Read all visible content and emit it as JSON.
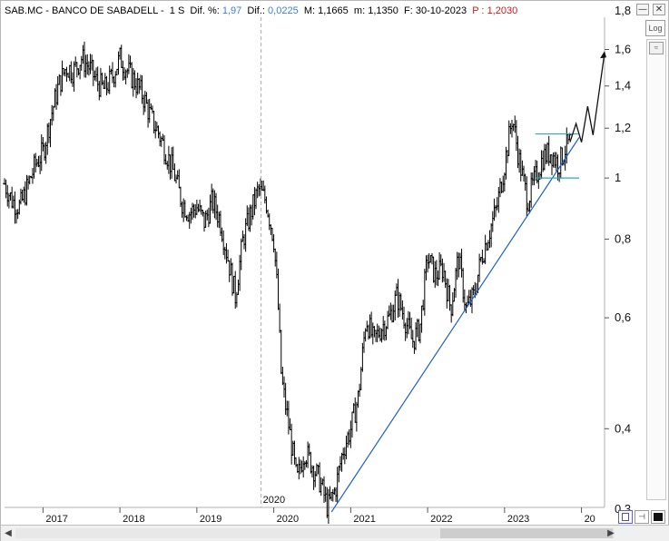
{
  "header": {
    "symbol": "SAB.MC - BANCO DE SABADELL -",
    "period": "1 S",
    "dif_pct_label": "Dif. %:",
    "dif_pct_value": "1,97",
    "dif_label": "Dif.:",
    "dif_value": "0,0225",
    "max_label": "M:",
    "max_value": "1,1665",
    "min_label": "m:",
    "min_value": "1,1350",
    "date_label": "F:",
    "date_value": "30-10-2023",
    "price_label": "P :",
    "price_value": "1,2030"
  },
  "controls": {
    "log_label": "Log",
    "minimize": "—",
    "close": "✕"
  },
  "colors": {
    "header_blue": "#3b7fd9",
    "header_red": "#d01818",
    "trendline": "#1a5fd0",
    "channel": "#2aa8c0",
    "bars": "#000000"
  },
  "icons": [
    "scroll-left-icon",
    "scroll-right-icon",
    "save-icon",
    "pin-icon",
    "color-icon",
    "chevron-collapse-icon"
  ],
  "chart_data": {
    "type": "ohlc",
    "scale": "log",
    "ylim": [
      0.3,
      1.8
    ],
    "y_ticks": [
      {
        "value": 1.6,
        "label": "1,6"
      },
      {
        "value": 1.4,
        "label": "1,4"
      },
      {
        "value": 1.2,
        "label": "1,2"
      },
      {
        "value": 1.0,
        "label": "1"
      },
      {
        "value": 0.8,
        "label": "0,8"
      },
      {
        "value": 0.6,
        "label": "0,6"
      },
      {
        "value": 0.4,
        "label": "0,4"
      }
    ],
    "y_partial_labels": [
      {
        "value": 1.8,
        "label": "1,8"
      },
      {
        "value": 0.3,
        "label": "0,3"
      }
    ],
    "x_ticks": [
      "2017",
      "2018",
      "2019",
      "2020",
      "2021",
      "2022",
      "2023",
      "20"
    ],
    "x_marker_label": "2020",
    "x_range": [
      2016.5,
      2024.3
    ],
    "price_path": [
      [
        2016.5,
        0.98
      ],
      [
        2016.6,
        0.92
      ],
      [
        2016.7,
        0.9
      ],
      [
        2016.8,
        0.97
      ],
      [
        2016.9,
        1.05
      ],
      [
        2017.0,
        1.1
      ],
      [
        2017.1,
        1.25
      ],
      [
        2017.2,
        1.4
      ],
      [
        2017.3,
        1.5
      ],
      [
        2017.4,
        1.48
      ],
      [
        2017.5,
        1.55
      ],
      [
        2017.6,
        1.5
      ],
      [
        2017.7,
        1.42
      ],
      [
        2017.8,
        1.38
      ],
      [
        2017.9,
        1.45
      ],
      [
        2018.0,
        1.55
      ],
      [
        2018.1,
        1.48
      ],
      [
        2018.2,
        1.42
      ],
      [
        2018.3,
        1.35
      ],
      [
        2018.4,
        1.25
      ],
      [
        2018.5,
        1.18
      ],
      [
        2018.6,
        1.1
      ],
      [
        2018.7,
        1.02
      ],
      [
        2018.8,
        0.92
      ],
      [
        2018.9,
        0.88
      ],
      [
        2019.0,
        0.9
      ],
      [
        2019.1,
        0.85
      ],
      [
        2019.2,
        0.92
      ],
      [
        2019.3,
        0.86
      ],
      [
        2019.4,
        0.75
      ],
      [
        2019.5,
        0.65
      ],
      [
        2019.6,
        0.8
      ],
      [
        2019.7,
        0.88
      ],
      [
        2019.8,
        0.96
      ],
      [
        2019.9,
        0.92
      ],
      [
        2020.0,
        0.8
      ],
      [
        2020.05,
        0.65
      ],
      [
        2020.1,
        0.48
      ],
      [
        2020.2,
        0.4
      ],
      [
        2020.3,
        0.33
      ],
      [
        2020.4,
        0.37
      ],
      [
        2020.5,
        0.35
      ],
      [
        2020.6,
        0.33
      ],
      [
        2020.7,
        0.3
      ],
      [
        2020.8,
        0.32
      ],
      [
        2020.9,
        0.37
      ],
      [
        2021.0,
        0.4
      ],
      [
        2021.1,
        0.45
      ],
      [
        2021.2,
        0.6
      ],
      [
        2021.3,
        0.55
      ],
      [
        2021.4,
        0.58
      ],
      [
        2021.5,
        0.6
      ],
      [
        2021.6,
        0.65
      ],
      [
        2021.7,
        0.6
      ],
      [
        2021.8,
        0.55
      ],
      [
        2021.9,
        0.58
      ],
      [
        2022.0,
        0.75
      ],
      [
        2022.1,
        0.7
      ],
      [
        2022.2,
        0.72
      ],
      [
        2022.3,
        0.62
      ],
      [
        2022.4,
        0.75
      ],
      [
        2022.5,
        0.62
      ],
      [
        2022.6,
        0.65
      ],
      [
        2022.7,
        0.75
      ],
      [
        2022.8,
        0.82
      ],
      [
        2022.9,
        0.9
      ],
      [
        2023.0,
        1.05
      ],
      [
        2023.1,
        1.25
      ],
      [
        2023.2,
        1.05
      ],
      [
        2023.3,
        0.92
      ],
      [
        2023.4,
        1.0
      ],
      [
        2023.5,
        1.08
      ],
      [
        2023.6,
        1.1
      ],
      [
        2023.7,
        1.05
      ],
      [
        2023.8,
        1.12
      ],
      [
        2023.85,
        1.14
      ]
    ],
    "trendline": [
      [
        2020.75,
        0.295
      ],
      [
        2023.97,
        1.16
      ]
    ],
    "channel_top": {
      "value": 1.175,
      "x": [
        2023.4,
        2023.97
      ]
    },
    "channel_bottom": {
      "value": 1.0,
      "x": [
        2023.4,
        2023.97
      ]
    },
    "projection": [
      [
        2023.85,
        1.14
      ],
      [
        2023.93,
        1.22
      ],
      [
        2024.0,
        1.14
      ],
      [
        2024.08,
        1.3
      ],
      [
        2024.15,
        1.17
      ],
      [
        2024.3,
        1.58
      ]
    ]
  }
}
